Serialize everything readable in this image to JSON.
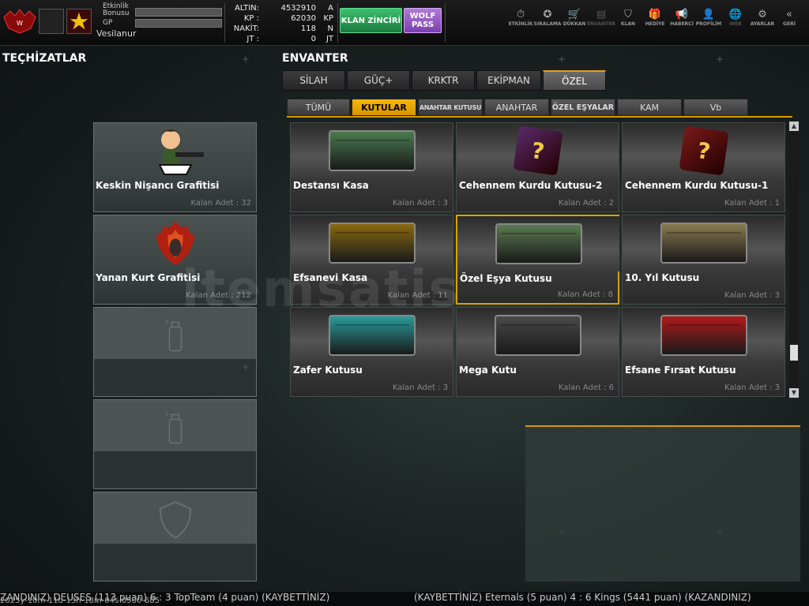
{
  "header": {
    "event_label": "Etkinlik\nBonusu",
    "gp_label": "GP",
    "username": "Vesilanur",
    "currency": [
      {
        "label": "ALTIN:",
        "value": "4532910",
        "unit": "A"
      },
      {
        "label": "KP :",
        "value": "62030",
        "unit": "KP"
      },
      {
        "label": "NAKİT:",
        "value": "118",
        "unit": "N"
      },
      {
        "label": "JT :",
        "value": "0",
        "unit": "JT"
      }
    ],
    "klan_button": "KLAN ZİNCİRİ",
    "wolf_button": "WOLF\nPASS",
    "nav": [
      {
        "icon": "⏱",
        "label": "ETKİNLİK",
        "name": "nav-etkinlik",
        "dim": false
      },
      {
        "icon": "✪",
        "label": "SIRALAMA",
        "name": "nav-siralama",
        "dim": false
      },
      {
        "icon": "🛒",
        "label": "DÜKKAN",
        "name": "nav-dukkan",
        "dim": false
      },
      {
        "icon": "▤",
        "label": "ENVANTER",
        "name": "nav-envanter",
        "dim": true
      },
      {
        "icon": "⛉",
        "label": "KLAN",
        "name": "nav-klan",
        "dim": false
      },
      {
        "icon": "🎁",
        "label": "HEDİYE",
        "name": "nav-hediye",
        "dim": false
      },
      {
        "icon": "📢",
        "label": "HABERCİ",
        "name": "nav-haberci",
        "dim": false
      },
      {
        "icon": "👤",
        "label": "PROFİLİM",
        "name": "nav-profilim",
        "dim": false
      },
      {
        "icon": "🌐",
        "label": "WEB",
        "name": "nav-web",
        "dim": true
      },
      {
        "icon": "⚙",
        "label": "AYARLAR",
        "name": "nav-ayarlar",
        "dim": false
      },
      {
        "icon": "«",
        "label": "GERİ",
        "name": "nav-geri",
        "dim": false
      }
    ]
  },
  "equipment": {
    "title": "TEÇHİZATLAR",
    "slots": [
      {
        "name": "Keskin Nişancı Grafitisi",
        "count": "Kalan Adet : 32",
        "icon": "graffiti-soldier-icon"
      },
      {
        "name": "Yanan Kurt Grafitisi",
        "count": "Kalan Adet : 212",
        "icon": "burning-wolf-icon"
      }
    ]
  },
  "inventory": {
    "title": "ENVANTER",
    "tabs": [
      "SİLAH",
      "GÜÇ+",
      "KRKTR",
      "EKİPMAN",
      "ÖZEL"
    ],
    "subtabs": [
      "TÜMÜ",
      "KUTULAR",
      "ANAHTAR KUTUSU",
      "ANAHTAR",
      "ÖZEL EŞYALAR",
      "KAM",
      "Vb"
    ],
    "items": [
      {
        "name": "Destansı Kasa",
        "count": "Kalan Adet : 3",
        "color": "#4a7a4e"
      },
      {
        "name": "Cehennem Kurdu Kutusu-2",
        "count": "Kalan Adet : 2",
        "color": "#5a2a6a"
      },
      {
        "name": "Cehennem Kurdu Kutusu-1",
        "count": "Kalan Adet : 1",
        "color": "#7a1a1a"
      },
      {
        "name": "Efsanevi Kasa",
        "count": "Kalan Adet : 11",
        "color": "#8a6a10"
      },
      {
        "name": "Özel Eşya Kutusu",
        "count": "Kalan Adet : 8",
        "color": "#5a7a50"
      },
      {
        "name": "10. Yıl Kutusu",
        "count": "Kalan Adet : 3",
        "color": "#8a7a50"
      },
      {
        "name": "Zafer Kutusu",
        "count": "Kalan Adet : 3",
        "color": "#2a9a9a"
      },
      {
        "name": "Mega Kutu",
        "count": "Kalan Adet : 6",
        "color": "#4a4a4a"
      },
      {
        "name": "Efsane Fırsat Kutusu",
        "count": "Kalan Adet : 3",
        "color": "#b01a1a"
      }
    ]
  },
  "watermark": "itemsatis",
  "ticker": {
    "left": "ZANDINIZ) DEUSES (113 puan) 6 : 3 TopTeam (4 puan) (KAYBETTİNİZ)",
    "right": "(KAYBETTİNİZ) Eternals (5 puan) 4 : 6 Kings (5441 puan) (KAZANDINIZ)",
    "timestamp": "2025y-10m-11d-13h-18m-04s-0500-685"
  }
}
